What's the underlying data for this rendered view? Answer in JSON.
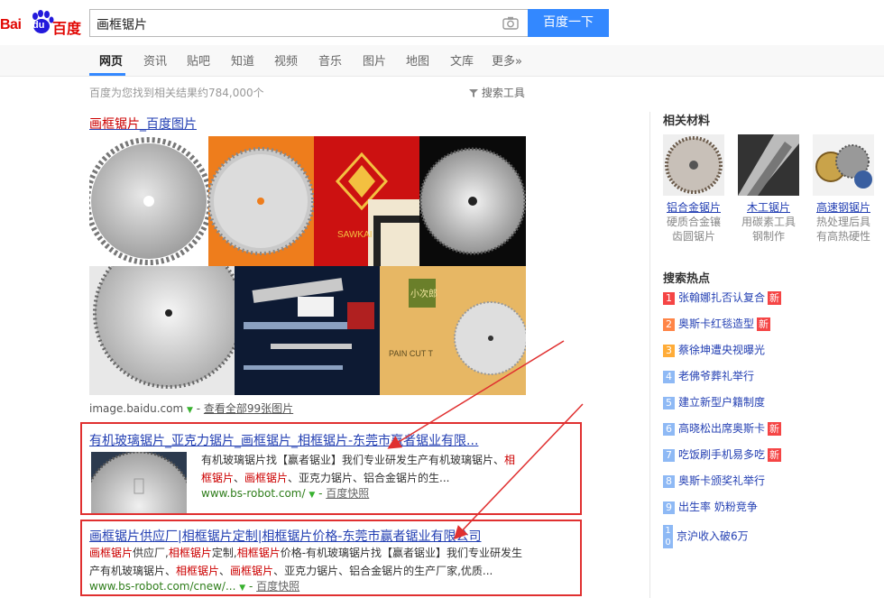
{
  "logo": {
    "bai": "Bai",
    "du": "du",
    "cn": "百度"
  },
  "search": {
    "query": "画框锯片",
    "button": "百度一下"
  },
  "tabs": [
    "网页",
    "资讯",
    "贴吧",
    "知道",
    "视频",
    "音乐",
    "图片",
    "地图",
    "文库",
    "更多»"
  ],
  "result_count": "百度为您找到相关结果约784,000个",
  "tools_label": "搜索工具",
  "image_result": {
    "title_hl": "画框锯片",
    "title_rest": "_百度图片",
    "source": "image.baidu.com",
    "more_link": "查看全部99张图片",
    "thumb_text_sawkai": "SAWKAI",
    "thumb_text_box": "小次郎",
    "thumb_text_paincut": "PAIN CUT T"
  },
  "result1": {
    "title": "有机玻璃锯片_亚克力锯片_画框锯片_相框锯片-东莞市赢者锯业有限...",
    "snippet": [
      {
        "t": "有机玻璃锯片找【赢者锯业】我们专业研发生产有机玻璃锯片、",
        "h": false
      },
      {
        "t": "相框锯片",
        "h": true
      },
      {
        "t": "、",
        "h": false
      },
      {
        "t": "画框锯片",
        "h": true
      },
      {
        "t": "、亚克力锯片、铝合金锯片的生...",
        "h": false
      }
    ],
    "url": "www.bs-robot.com/",
    "cache": "百度快照"
  },
  "result2": {
    "title": "画框锯片供应厂|相框锯片定制|相框锯片价格-东莞市赢者锯业有限公司",
    "snippet": [
      {
        "t": "画框锯片",
        "h": true
      },
      {
        "t": "供应厂,",
        "h": false
      },
      {
        "t": "相框锯片",
        "h": true
      },
      {
        "t": "定制,",
        "h": false
      },
      {
        "t": "相框锯片",
        "h": true
      },
      {
        "t": "价格-有机玻璃锯片找【赢者锯业】我们专业研发生产有机玻璃锯片、",
        "h": false
      },
      {
        "t": "相框锯片",
        "h": true
      },
      {
        "t": "、",
        "h": false
      },
      {
        "t": "画框锯片",
        "h": true
      },
      {
        "t": "、亚克力锯片、铝合金锯片的生产厂家,优质...",
        "h": false
      }
    ],
    "url": "www.bs-robot.com/cnew/...",
    "cache": "百度快照"
  },
  "related": {
    "title": "相关材料",
    "items": [
      {
        "name": "铝合金锯片",
        "desc1": "硬质合金镶",
        "desc2": "齿圆锯片"
      },
      {
        "name": "木工锯片",
        "desc1": "用碳素工具",
        "desc2": "钢制作"
      },
      {
        "name": "高速钢锯片",
        "desc1": "热处理后具",
        "desc2": "有高热硬性"
      }
    ]
  },
  "hot": {
    "title": "搜索热点",
    "new_label": "新",
    "items": [
      {
        "num": "1",
        "text": "张翰娜扎否认复合",
        "new": true,
        "color": "#f54545"
      },
      {
        "num": "2",
        "text": "奥斯卡红毯造型",
        "new": true,
        "color": "#ff8547"
      },
      {
        "num": "3",
        "text": "蔡徐坤遭央视曝光",
        "new": false,
        "color": "#ffac38"
      },
      {
        "num": "4",
        "text": "老佛爷葬礼举行",
        "new": false,
        "color": "#8eb9f5"
      },
      {
        "num": "5",
        "text": "建立新型户籍制度",
        "new": false,
        "color": "#8eb9f5"
      },
      {
        "num": "6",
        "text": "高晓松出席奥斯卡",
        "new": true,
        "color": "#8eb9f5"
      },
      {
        "num": "7",
        "text": "吃饭刷手机易多吃",
        "new": true,
        "color": "#8eb9f5"
      },
      {
        "num": "8",
        "text": "奥斯卡颁奖礼举行",
        "new": false,
        "color": "#8eb9f5"
      },
      {
        "num": "9",
        "text": "出生率 奶粉竞争",
        "new": false,
        "color": "#8eb9f5"
      },
      {
        "num": "10",
        "text": "京沪收入破6万",
        "new": false,
        "color": "#8eb9f5"
      }
    ]
  }
}
